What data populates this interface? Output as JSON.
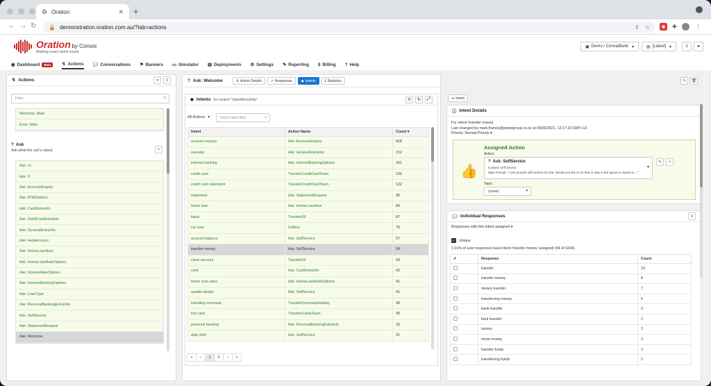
{
  "browser": {
    "tab_title": "Oration",
    "url": "demonstration.oration.com.au/?tab=actions"
  },
  "header": {
    "brand": "Oration",
    "by": "by Convoi",
    "tagline": "Making every word count.",
    "project_select": "Demo / ConvaiBank",
    "version_select": "[Latest]"
  },
  "menu": [
    {
      "label": "Dashboard",
      "badge": "Beta",
      "icon": "dashboard-icon"
    },
    {
      "label": "Actions",
      "icon": "actions-icon"
    },
    {
      "label": "Conversations",
      "icon": "conversations-icon"
    },
    {
      "label": "Banners",
      "icon": "banners-icon"
    },
    {
      "label": "Simulator",
      "icon": "simulator-icon"
    },
    {
      "label": "Deployments",
      "icon": "deployments-icon"
    },
    {
      "label": "Settings",
      "icon": "settings-icon"
    },
    {
      "label": "Reporting",
      "icon": "reporting-icon"
    },
    {
      "label": "Billing",
      "icon": "billing-icon"
    },
    {
      "label": "Help",
      "icon": "help-icon"
    }
  ],
  "actions_panel": {
    "title": "Actions",
    "filter_placeholder": "Filter",
    "top_items": [
      "Welcome: Main",
      "Error: Main"
    ],
    "ask_title": "Ask",
    "ask_subtitle": "Ask what the call is about",
    "ask_items": [
      "Ask: 11",
      "Ask: 9",
      "Ask: AccountEnquiry",
      "Ask: ATMOptions",
      "Ask: CardExtraInfo",
      "Ask: DebitCardExtraInfo",
      "Ask: GeneralExtraInfo",
      "Ask: HelpAccount",
      "Ask: HomeLoanNew",
      "Ask: HomeLoanRateOptions",
      "Ask: InterestRateOptions",
      "Ask: InternetBankingOptions",
      "Ask: LoanType",
      "Ask: PersonalBankingExtraInfo",
      "Ask: SelfService",
      "Ask: StatementRequest",
      "Ask: Welcome"
    ],
    "selected_item": "Ask: Welcome"
  },
  "middle_panel": {
    "title": "Ask: Welcome",
    "tabs": [
      "Action Details",
      "Responses",
      "Intents",
      "Statistics"
    ],
    "active_tab": "Intents",
    "intents_title": "Intents",
    "intents_context": "for context \"OpenMenuHelp\"",
    "filter_select": "All Actions",
    "intent_filter_placeholder": "Intent name filter",
    "columns": [
      "Intent",
      "Action Name",
      "Count"
    ],
    "rows": [
      [
        "account enquiry",
        "Ask: AccountEnquiry",
        "418"
      ],
      [
        "operator",
        "Ask: GeneralExtraInfo",
        "212"
      ],
      [
        "internet banking",
        "Ask: InternetBankingOptions",
        "161"
      ],
      [
        "credit card",
        "TransferCreditCardTeam",
        "135"
      ],
      [
        "credit card statement",
        "TransferCreditCardTeam",
        "122"
      ],
      [
        "statement",
        "Ask: StatementRequest",
        "95"
      ],
      [
        "home loan",
        "Ask: HomeLoanNew",
        "89"
      ],
      [
        "fraud",
        "Transfer26",
        "87"
      ],
      [
        "car loan",
        "Deflect",
        "75"
      ],
      [
        "account balance",
        "Ask: SelfService",
        "57"
      ],
      [
        "transfer money",
        "Ask: SelfService",
        "54"
      ],
      [
        "close account",
        "Transfer25",
        "43"
      ],
      [
        "card",
        "Ask: CardExtraInfo",
        "42"
      ],
      [
        "home loan rates",
        "Ask: HomeLoanRateOptions",
        "41"
      ],
      [
        "update details",
        "Ask: SelfService",
        "41"
      ],
      [
        "travelling overseas",
        "TransferOverseasHoliday",
        "36"
      ],
      [
        "lost card",
        "TransferCardsTeam",
        "35"
      ],
      [
        "personal banking",
        "Ask: PersonalBankingExtraInfo",
        "33"
      ],
      [
        "daily limit",
        "Ask: SelfService",
        "31"
      ]
    ],
    "selected_row": "transfer money",
    "pager": [
      "«",
      "‹",
      "1",
      "2",
      "›",
      "»"
    ]
  },
  "right_panel": {
    "intent_btn": "Intent",
    "details_title": "Intent Details",
    "for_intent": "For intent 'transfer money'",
    "changed_by": "Last changed by mark.francis@probegroup.co.nz at 09/06/2021, 13:17:19 GMT+12",
    "priority": "Priority: Normal Priority",
    "assigned_title": "Assigned Action",
    "action_label": "Action:",
    "action_name": "Ask: SelfService",
    "context_text": "Context: self service",
    "prompt_text": "Main Prompt: \"I can provide self service for that. Would you like to try that or stay in the queue to speak to ...\"",
    "topic_label": "Topic:",
    "topic_value": "(none)",
    "responses_title": "Individual Responses",
    "responses_filter": "Responses with this intent assigned",
    "unique_label": "Unique",
    "summary": "1.01% of user responses have intent 'transfer money' assigned (54 of 5324).",
    "resp_columns": [
      "Response",
      "Count"
    ],
    "responses": [
      [
        "transfer",
        "10"
      ],
      [
        "transfer money",
        "8"
      ],
      [
        "money transfer",
        "7"
      ],
      [
        "transferring money",
        "6"
      ],
      [
        "bank transfer",
        "3"
      ],
      [
        "fund transfer",
        "2"
      ],
      [
        "money",
        "2"
      ],
      [
        "move money",
        "2"
      ],
      [
        "transfer funds",
        "2"
      ],
      [
        "transferring funds",
        "2"
      ]
    ]
  }
}
